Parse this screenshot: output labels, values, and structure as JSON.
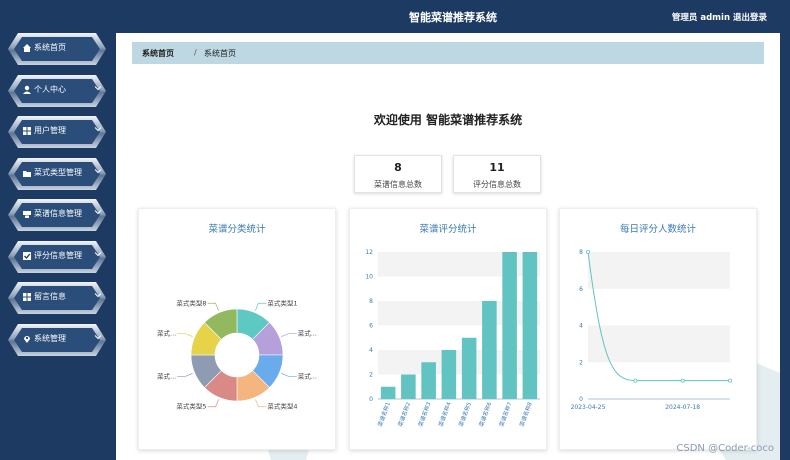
{
  "header": {
    "title": "智能菜谱推荐系统",
    "user": "管理员 admin",
    "logout": "退出登录"
  },
  "sidebar": {
    "items": [
      {
        "label": "系统首页",
        "icon": "home-icon",
        "has_chevron": false
      },
      {
        "label": "个人中心",
        "icon": "user-icon",
        "has_chevron": true
      },
      {
        "label": "用户管理",
        "icon": "grid-icon",
        "has_chevron": true
      },
      {
        "label": "菜式类型管理",
        "icon": "folder-icon",
        "has_chevron": true
      },
      {
        "label": "菜谱信息管理",
        "icon": "card-icon",
        "has_chevron": true
      },
      {
        "label": "评分信息管理",
        "icon": "check-icon",
        "has_chevron": true
      },
      {
        "label": "留言信息",
        "icon": "grid-icon",
        "has_chevron": true
      },
      {
        "label": "系统管理",
        "icon": "pin-icon",
        "has_chevron": true
      }
    ]
  },
  "breadcrumb": {
    "home": "系统首页",
    "separator": "/",
    "current": "系统首页"
  },
  "welcome": "欢迎使用 智能菜谱推荐系统",
  "stats": [
    {
      "value": "8",
      "label": "菜谱信息总数"
    },
    {
      "value": "11",
      "label": "评分信息总数"
    }
  ],
  "watermark": "CSDN @Coder-coco",
  "colors": {
    "accent": "#61c4c3",
    "navy": "#1d3a63",
    "title": "#3a7ab3"
  },
  "chart_data": [
    {
      "type": "pie",
      "title": "菜谱分类统计",
      "donut": true,
      "categories": [
        "菜式类型1",
        "菜式...",
        "菜式...",
        "菜式类型4",
        "菜式类型5",
        "菜式...",
        "菜式...",
        "菜式类型8"
      ],
      "values": [
        1,
        1,
        1,
        1,
        1,
        1,
        1,
        1
      ],
      "colors": [
        "#5ec8c3",
        "#b5a0dc",
        "#6aabeb",
        "#f5b57f",
        "#d98a87",
        "#8f9bb3",
        "#e6d34a",
        "#93b960"
      ]
    },
    {
      "type": "bar",
      "title": "菜谱评分统计",
      "categories": [
        "菜谱名称1",
        "菜谱名称2",
        "菜谱名称3",
        "菜谱名称4",
        "菜谱名称5",
        "菜谱名称6",
        "菜谱名称7",
        "菜谱名称8"
      ],
      "values": [
        1,
        2,
        3,
        4,
        5,
        8,
        12,
        12
      ],
      "ylim": [
        0,
        12
      ],
      "yticks": [
        0,
        2,
        4,
        6,
        8,
        10,
        12
      ],
      "color": "#61c4c3"
    },
    {
      "type": "line",
      "title": "每日评分人数统计",
      "x_tick_labels": [
        "2023-04-25",
        "2024-07-18"
      ],
      "y": [
        8,
        1,
        1,
        1
      ],
      "ylim": [
        0,
        8
      ],
      "yticks": [
        0,
        2,
        4,
        6,
        8
      ],
      "color": "#61c4c3"
    }
  ]
}
